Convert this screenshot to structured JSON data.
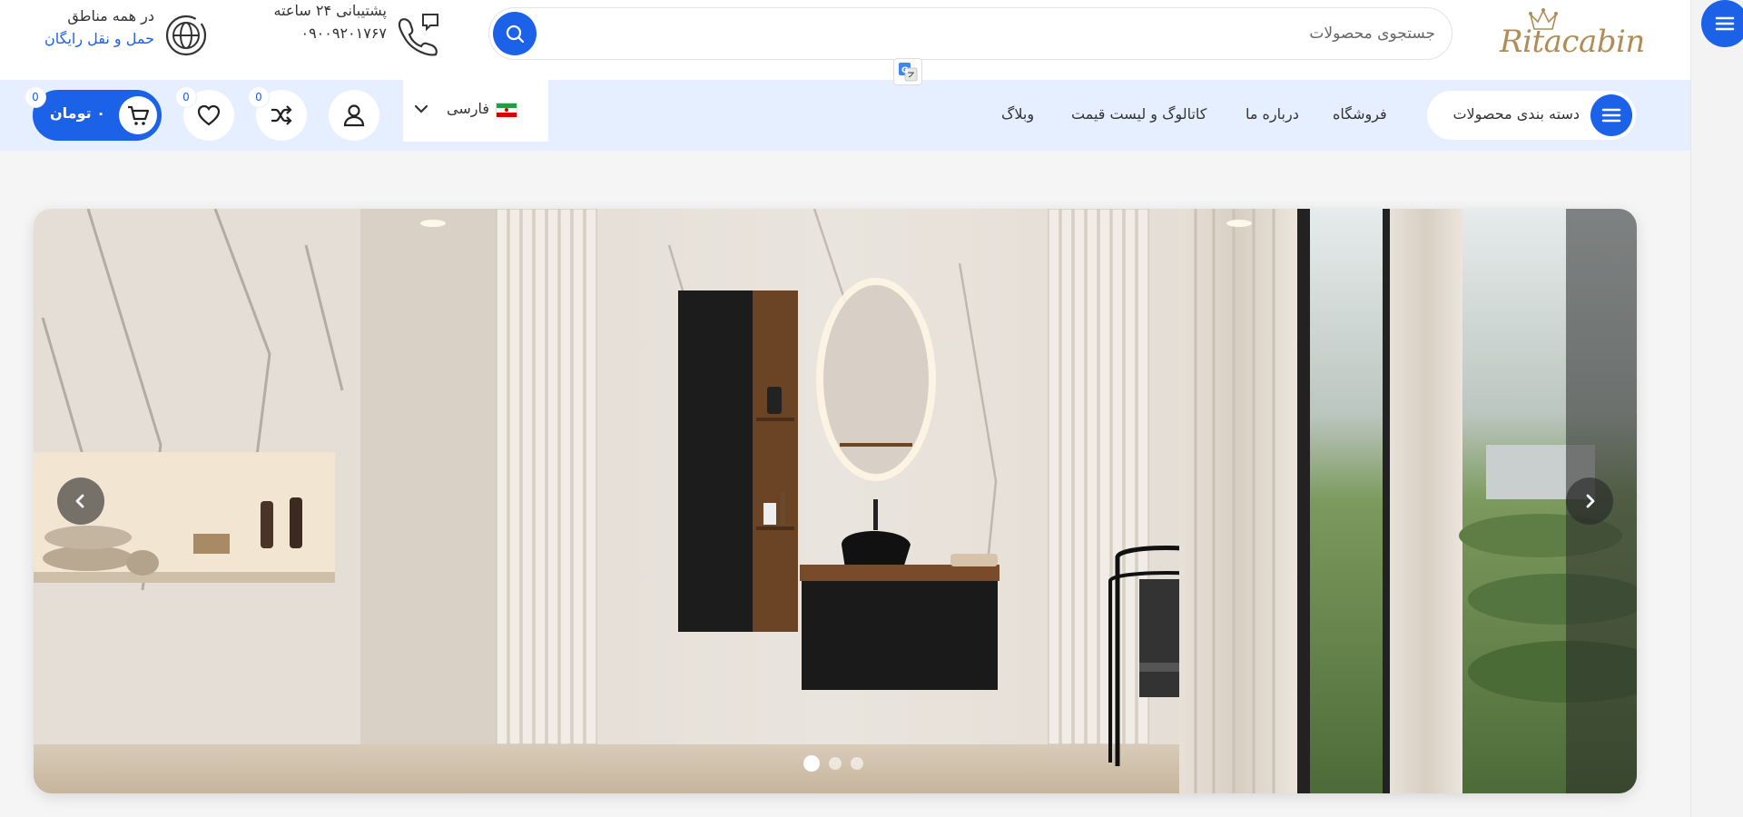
{
  "brand": {
    "logo_text": "Ritacabin"
  },
  "search": {
    "placeholder": "جستجوی محصولات"
  },
  "support": {
    "title": "پشتیبانی ۲۴ ساعته",
    "phone": "۰۹۰۰۹۲۰۱۷۶۷"
  },
  "delivery": {
    "title": "در همه مناطق",
    "subtitle": "حمل و نقل رایگان"
  },
  "nav": {
    "categories_label": "دسته بندی محصولات",
    "links": [
      "فروشگاه",
      "درباره ما",
      "کاتالوگ و لیست قیمت",
      "وبلاگ"
    ]
  },
  "language": {
    "label": "فارسی"
  },
  "actions": {
    "compare_count": "0",
    "wishlist_count": "0",
    "cart_count": "0",
    "cart_total": "۰ تومان"
  },
  "slider": {
    "slides": 3,
    "active_index": 0
  },
  "colors": {
    "accent": "#1b62e8",
    "nav_bg": "#e6efff",
    "logo_gold": "#b08d57"
  },
  "icons": [
    "hamburger-icon",
    "search-icon",
    "google-translate-icon",
    "support-phone-icon",
    "globe-icon",
    "chevron-down-icon",
    "user-icon",
    "shuffle-icon",
    "heart-icon",
    "cart-icon",
    "arrow-left-icon",
    "arrow-right-icon"
  ]
}
